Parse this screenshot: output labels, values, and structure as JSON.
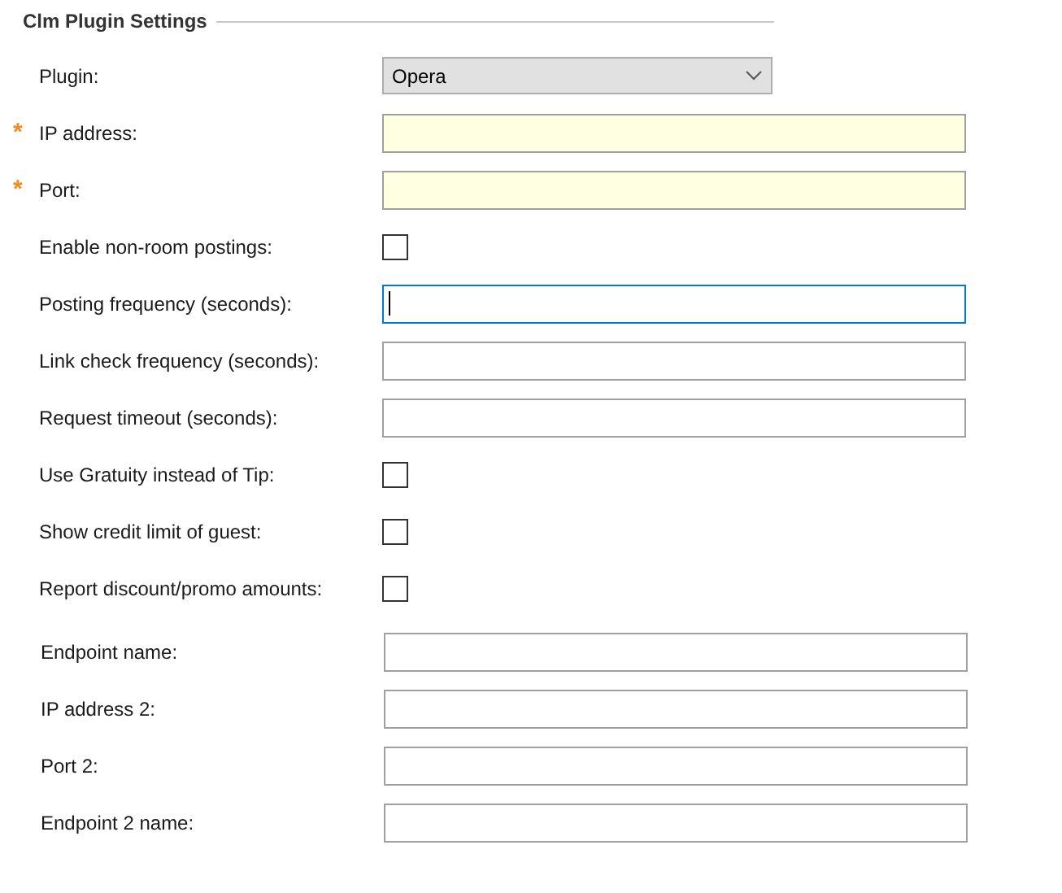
{
  "title": "Clm Plugin Settings",
  "fields": [
    {
      "kind": "select",
      "label": "Plugin:",
      "value": "Opera"
    },
    {
      "kind": "text",
      "label": "IP address:",
      "required": true,
      "required_mark": "*",
      "focused": false
    },
    {
      "kind": "text",
      "label": "Port:",
      "required": true,
      "required_mark": "*",
      "focused": false
    },
    {
      "kind": "checkbox",
      "label": "Enable non-room postings:",
      "checked": false
    },
    {
      "kind": "text",
      "label": "Posting frequency (seconds):",
      "focused": true
    },
    {
      "kind": "text",
      "label": "Link check frequency (seconds):",
      "focused": false
    },
    {
      "kind": "text",
      "label": "Request timeout (seconds):",
      "focused": false
    },
    {
      "kind": "checkbox",
      "label": "Use Gratuity instead of Tip:",
      "checked": false
    },
    {
      "kind": "checkbox",
      "label": "Show credit limit of guest:",
      "checked": false
    },
    {
      "kind": "checkbox",
      "label": "Report discount/promo amounts:",
      "checked": false
    }
  ],
  "endpoint_fields": [
    {
      "kind": "text",
      "label": "Endpoint name:",
      "focused": false
    },
    {
      "kind": "text",
      "label": "IP address 2:",
      "focused": false
    },
    {
      "kind": "text",
      "label": "Port 2:",
      "focused": false
    },
    {
      "kind": "text",
      "label": "Endpoint 2 name:",
      "focused": false
    }
  ]
}
